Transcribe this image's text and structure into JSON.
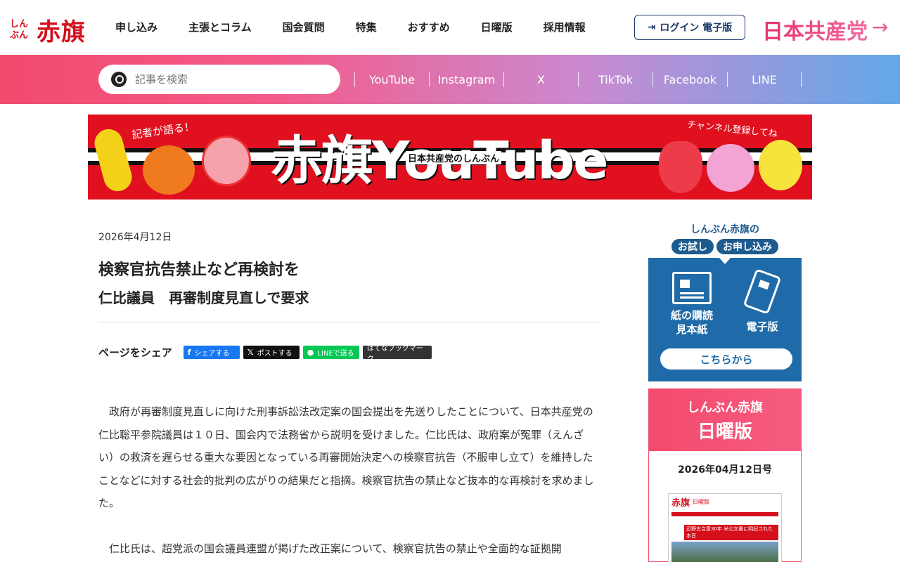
{
  "header": {
    "logo_small": "しんぶん",
    "logo_big": "赤旗",
    "nav": [
      "申し込み",
      "主張とコラム",
      "国会質問",
      "特集",
      "おすすめ",
      "日曜版",
      "採用情報"
    ],
    "login_label": "ログイン 電子版",
    "party_label": "日本共産党",
    "party_arrow": "→"
  },
  "search": {
    "placeholder": "記事を検索"
  },
  "social": [
    "YouTube",
    "Instagram",
    "X",
    "TikTok",
    "Facebook",
    "LINE"
  ],
  "banner": {
    "title": "赤旗YouTube",
    "subtitle": "日本共産党のしんぶん",
    "note_left": "記者が語る！",
    "note_right": "チャンネル登録してね"
  },
  "article": {
    "date": "2026年4月12日",
    "headline": "検察官抗告禁止など再検討を",
    "subhead": "仁比議員　再審制度見直しで要求",
    "share_label": "ページをシェア",
    "share_buttons": {
      "facebook": "シェアする",
      "x": "ポストする",
      "line": "LINEで送る",
      "hatena": "はてなブックマーク"
    },
    "paragraphs": [
      "政府が再審制度見直しに向けた刑事訴訟法改定案の国会提出を先送りしたことについて、日本共産党の仁比聡平参院議員は１０日、国会内で法務省から説明を受けました。仁比氏は、政府案が冤罪（えんざい）の救済を遅らせる重大な要因となっている再審開始決定への検察官抗告（不服申し立て）を維持したことなどに対する社会的批判の広がりの結果だと指摘。検察官抗告の禁止など抜本的な再検討を求めました。",
      "仁比氏は、超党派の国会議員連盟が掲げた改正案について、検察官抗告の禁止や全面的な証拠開"
    ]
  },
  "sidebar": {
    "trial": {
      "title": "しんぶん赤旗の",
      "pill1": "お試し",
      "pill2": "お申し込み",
      "paper_label_1": "紙の購読",
      "paper_label_2": "見本紙",
      "digital_label": "電子版",
      "button": "こちらから"
    },
    "sunday": {
      "line1": "しんぶん赤旗",
      "line2": "日曜版",
      "issue": "2026年04月12日号",
      "np_logo": "赤旗",
      "np_edition": "日曜版",
      "np_headline": "辺野古合意30年 米公文書に明記された本音"
    },
    "colors": {
      "blue": "#1f6aa8",
      "pink": "#f34a6d",
      "red": "#d50f1c"
    }
  }
}
